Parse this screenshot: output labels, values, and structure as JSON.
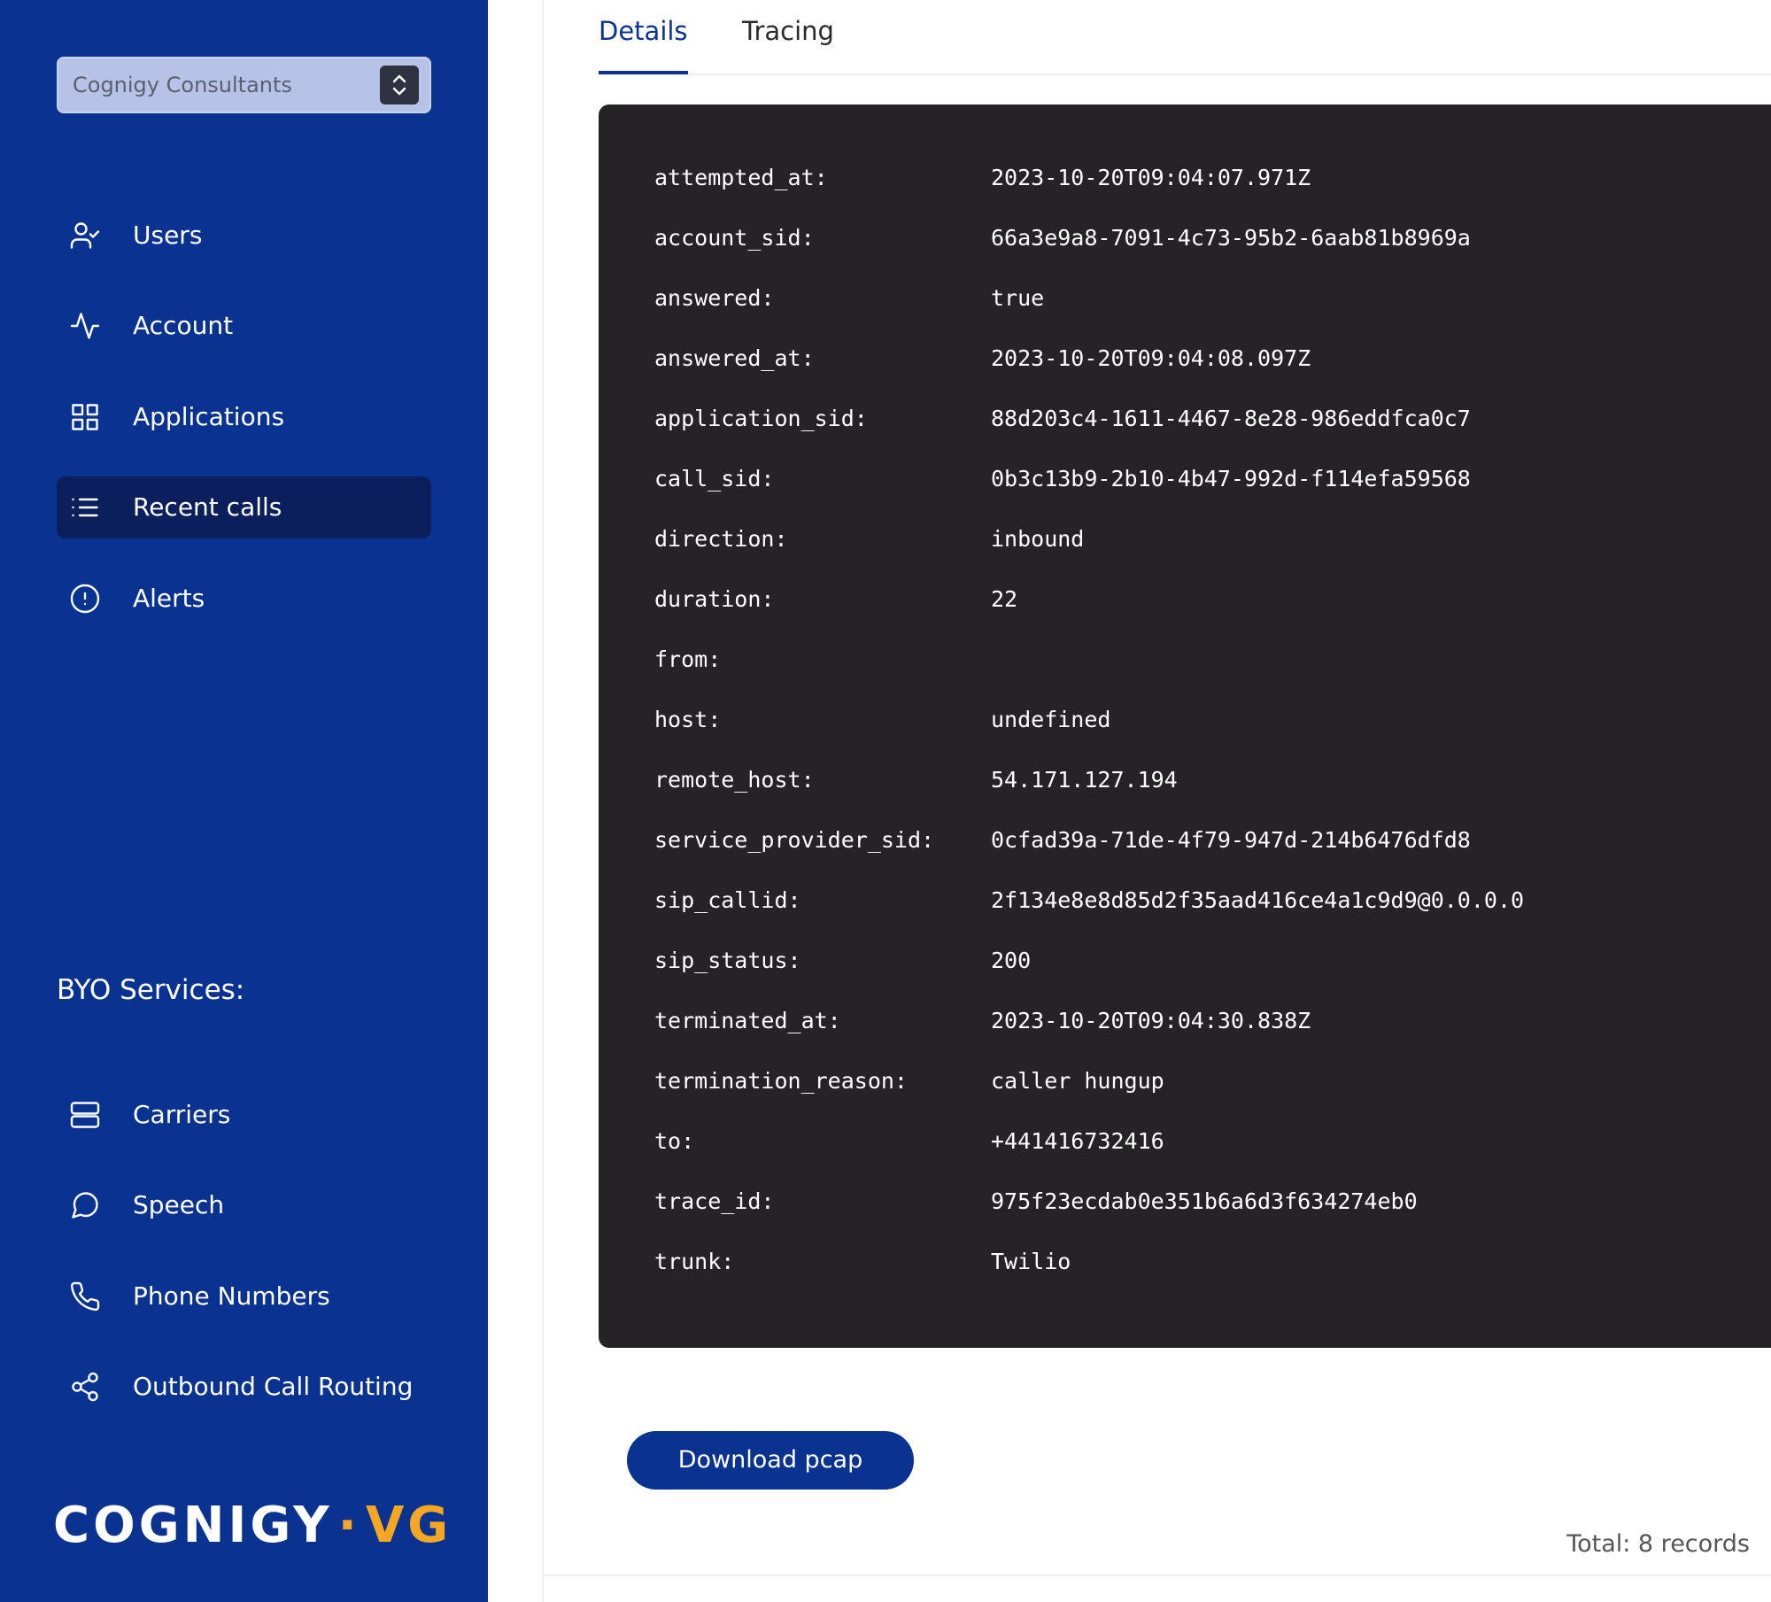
{
  "sidebar": {
    "account_selector": {
      "value": "Cognigy Consultants"
    },
    "nav": [
      {
        "label": "Users",
        "icon": "user-check-icon"
      },
      {
        "label": "Account",
        "icon": "activity-icon"
      },
      {
        "label": "Applications",
        "icon": "grid-icon"
      },
      {
        "label": "Recent calls",
        "icon": "list-icon",
        "active": true
      },
      {
        "label": "Alerts",
        "icon": "alert-circle-icon"
      }
    ],
    "byo_title": "BYO Services:",
    "byo_nav": [
      {
        "label": "Carriers",
        "icon": "server-icon"
      },
      {
        "label": "Speech",
        "icon": "message-circle-icon"
      },
      {
        "label": "Phone Numbers",
        "icon": "phone-icon"
      },
      {
        "label": "Outbound Call Routing",
        "icon": "share-icon"
      }
    ],
    "logo": {
      "main": "COGNIGY",
      "dot": "·",
      "accent": "VG"
    }
  },
  "tabs": [
    {
      "label": "Details",
      "active": true
    },
    {
      "label": "Tracing",
      "active": false
    }
  ],
  "details": [
    {
      "key": "attempted_at:",
      "value": "2023-10-20T09:04:07.971Z"
    },
    {
      "key": "account_sid:",
      "value": "66a3e9a8-7091-4c73-95b2-6aab81b8969a"
    },
    {
      "key": "answered:",
      "value": "true"
    },
    {
      "key": "answered_at:",
      "value": "2023-10-20T09:04:08.097Z"
    },
    {
      "key": "application_sid:",
      "value": "88d203c4-1611-4467-8e28-986eddfca0c7"
    },
    {
      "key": "call_sid:",
      "value": "0b3c13b9-2b10-4b47-992d-f114efa59568"
    },
    {
      "key": "direction:",
      "value": "inbound"
    },
    {
      "key": "duration:",
      "value": "22"
    },
    {
      "key": "from:",
      "value": ""
    },
    {
      "key": "host:",
      "value": "undefined"
    },
    {
      "key": "remote_host:",
      "value": "54.171.127.194"
    },
    {
      "key": "service_provider_sid:",
      "value": "0cfad39a-71de-4f79-947d-214b6476dfd8"
    },
    {
      "key": "sip_callid:",
      "value": "2f134e8e8d85d2f35aad416ce4a1c9d9@0.0.0.0"
    },
    {
      "key": "sip_status:",
      "value": "200"
    },
    {
      "key": "terminated_at:",
      "value": "2023-10-20T09:04:30.838Z"
    },
    {
      "key": "termination_reason:",
      "value": "caller hungup"
    },
    {
      "key": "to:",
      "value": "+441416732416"
    },
    {
      "key": "trace_id:",
      "value": "975f23ecdab0e351b6a6d3f634274eb0"
    },
    {
      "key": "trunk:",
      "value": "Twilio"
    }
  ],
  "actions": {
    "download_label": "Download pcap"
  },
  "footer": {
    "total_label": "Total: 8 records"
  },
  "colors": {
    "sidebar_bg": "#0a3391",
    "active_nav_bg": "#0a1f5c",
    "panel_bg": "#252325",
    "accent": "#f5a623"
  }
}
